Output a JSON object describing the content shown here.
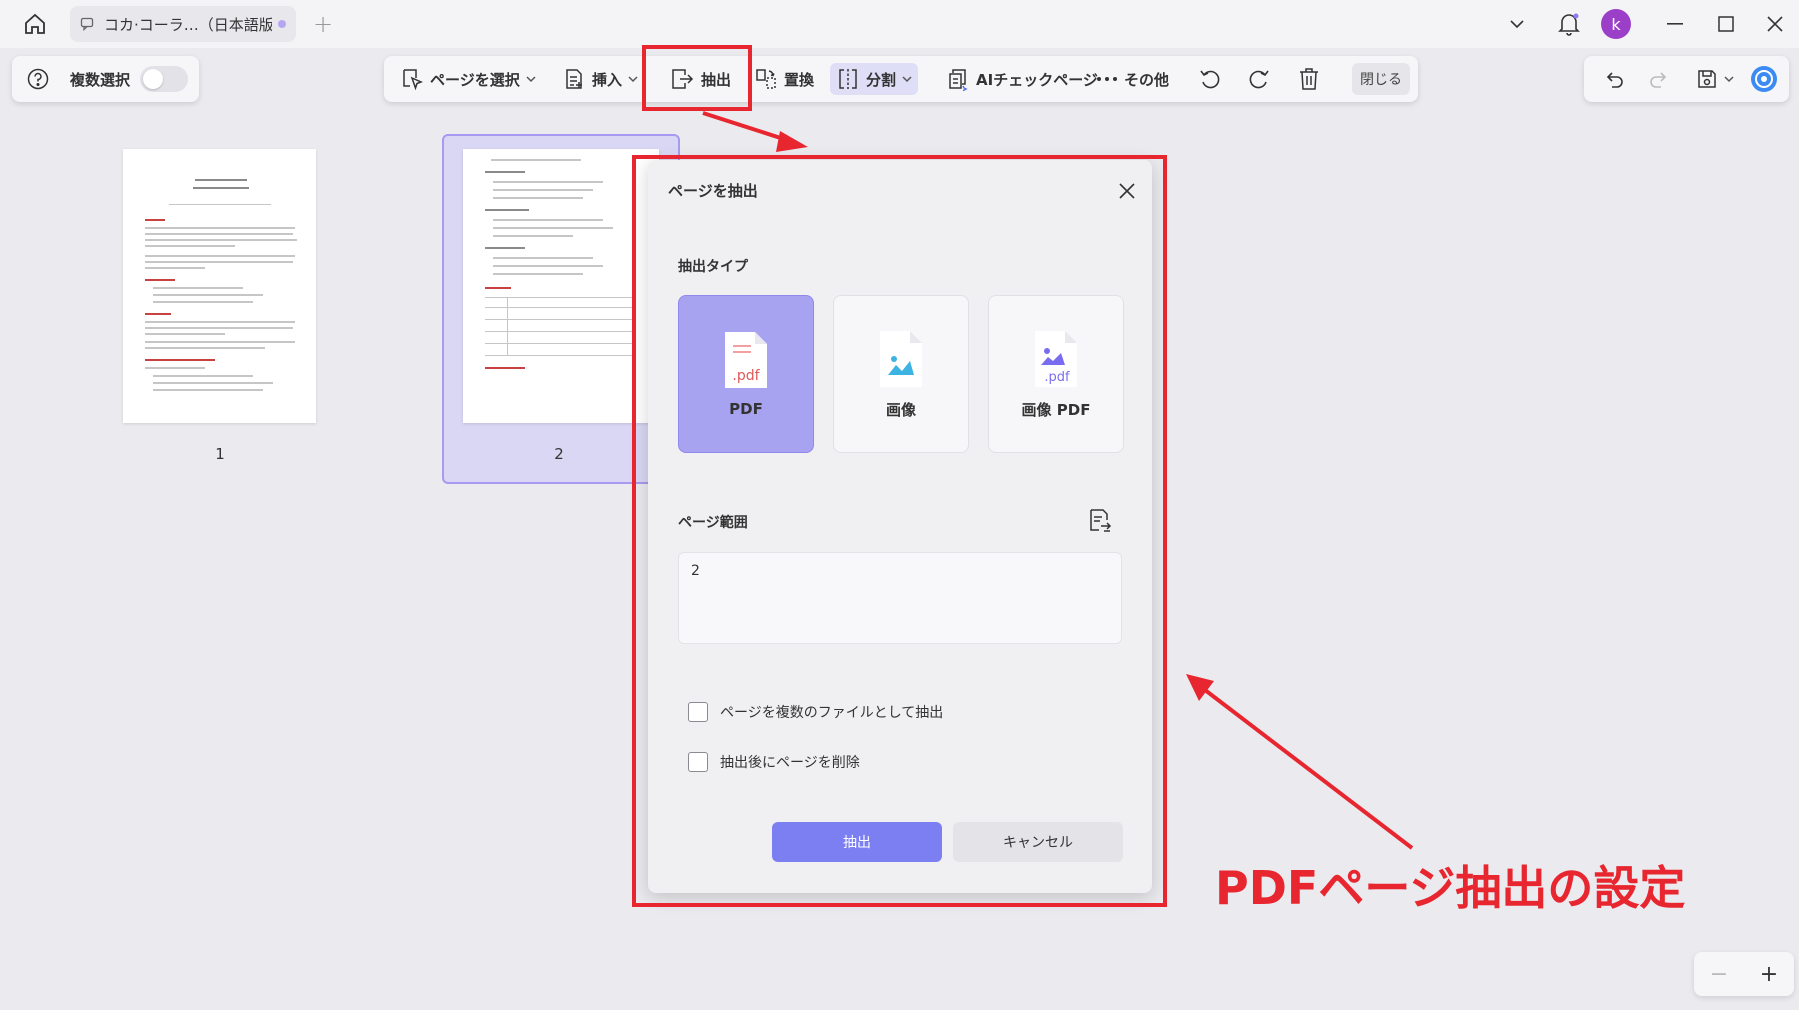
{
  "tab": {
    "title": "コカ·コーラ…（日本語版）",
    "new_tab": "+"
  },
  "user": {
    "avatar_letter": "k"
  },
  "multi_select": {
    "label": "複数選択"
  },
  "toolbar": {
    "select_page": "ページを選択",
    "insert": "挿入",
    "extract": "抽出",
    "replace": "置換",
    "split": "分割",
    "ai_check": "AIチェックページ",
    "more": "その他",
    "close": "閉じる"
  },
  "pages": [
    {
      "number": "1"
    },
    {
      "number": "2"
    }
  ],
  "dialog": {
    "title": "ページを抽出",
    "type_label": "抽出タイプ",
    "types": [
      {
        "label": "PDF",
        "selected": true
      },
      {
        "label": "画像",
        "selected": false
      },
      {
        "label": "画像 PDF",
        "selected": false
      }
    ],
    "range_label": "ページ範囲",
    "range_value": "2",
    "checkbox_multi": "ページを複数のファイルとして抽出",
    "checkbox_delete": "抽出後にページを削除",
    "extract_button": "抽出",
    "cancel_button": "キャンセル"
  },
  "annotation": {
    "caption": "PDFページ抽出の設定",
    "color": "#e8262f"
  },
  "zoom": {
    "minus": "−",
    "plus": "+"
  },
  "colors": {
    "accent": "#7b7ff2",
    "selected_card": "#a8a3f0",
    "avatar": "#9b3fc8"
  }
}
